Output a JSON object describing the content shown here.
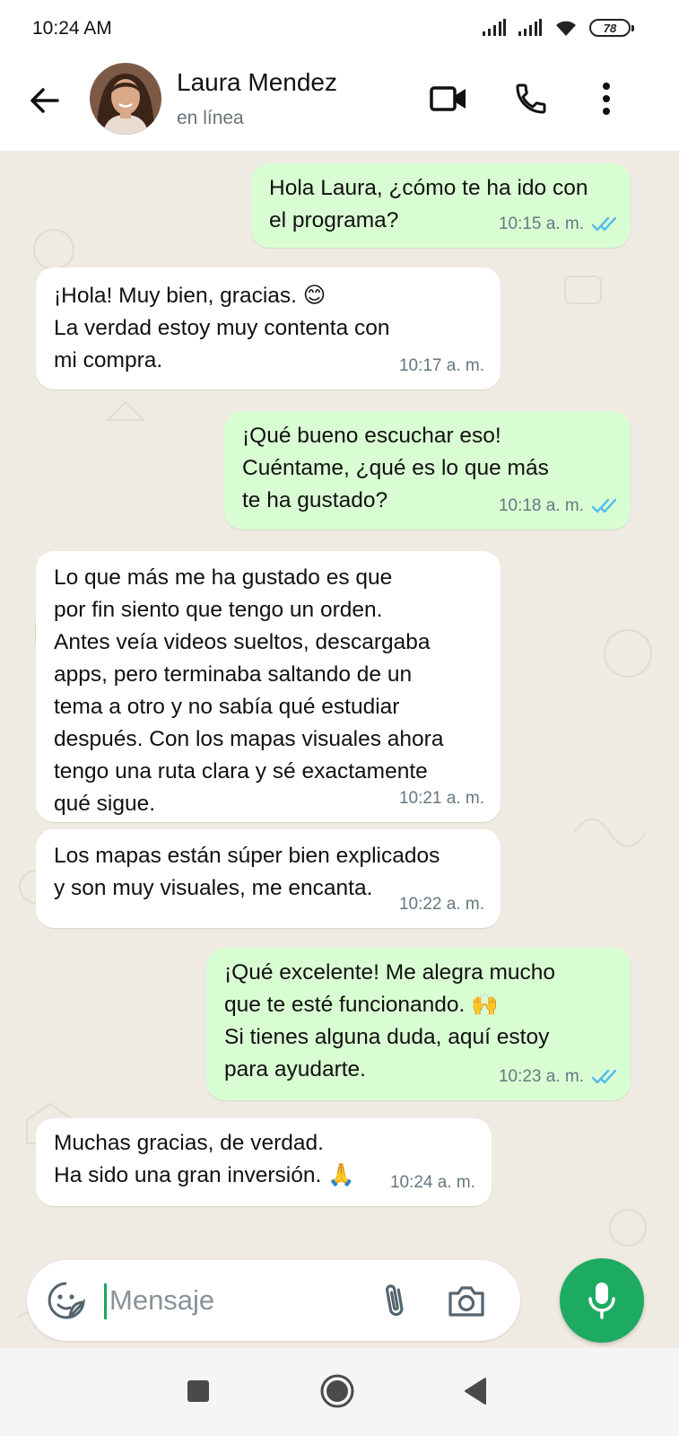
{
  "status_bar": {
    "time": "10:24 AM",
    "battery": "78"
  },
  "header": {
    "contact_name": "Laura Mendez",
    "contact_status": "en línea",
    "icons": [
      "back-arrow-icon",
      "video-call-icon",
      "phone-icon",
      "more-vert-icon"
    ]
  },
  "messages": [
    {
      "direction": "out",
      "text": "Hola Laura, ¿cómo te ha ido con\nel programa?",
      "time": "10:15 a. m.",
      "status": "read"
    },
    {
      "direction": "in",
      "text": "¡Hola! Muy bien, gracias. 😊\nLa verdad estoy muy contenta con\nmi compra.",
      "time": "10:17 a. m."
    },
    {
      "direction": "out",
      "text": "¡Qué bueno escuchar eso!\nCuéntame, ¿qué es lo que más\nte ha gustado?",
      "time": "10:18 a. m.",
      "status": "read"
    },
    {
      "direction": "in",
      "text": "Lo que más me ha gustado es que\npor fin siento que tengo un orden.\nAntes veía videos sueltos, descargaba\napps, pero terminaba saltando de un\ntema a otro y no sabía qué estudiar\ndespués. Con los mapas visuales ahora\ntengo una ruta clara y sé exactamente\nqué sigue.",
      "time": "10:21 a. m."
    },
    {
      "direction": "in",
      "text": "Los mapas están súper bien explicados\ny son muy visuales, me encanta.",
      "time": "10:22 a. m."
    },
    {
      "direction": "out",
      "text": "¡Qué excelente! Me alegra mucho\nque te esté funcionando. 🙌\nSi tienes alguna duda, aquí estoy\npara ayudarte.",
      "time": "10:23 a. m.",
      "status": "read"
    },
    {
      "direction": "in",
      "text": "Muchas gracias, de verdad.\nHa sido una gran inversión. 🙏",
      "time": "10:24 a. m."
    }
  ],
  "composer": {
    "placeholder": "Mensaje",
    "icons": [
      "sticker-icon",
      "attach-icon",
      "camera-icon",
      "mic-icon"
    ]
  },
  "colors": {
    "chat_background": "#efeae2",
    "outgoing_bubble": "#d9fdd3",
    "incoming_bubble": "#ffffff",
    "accent_green": "#1daa61",
    "read_ticks": "#53bdeb"
  }
}
